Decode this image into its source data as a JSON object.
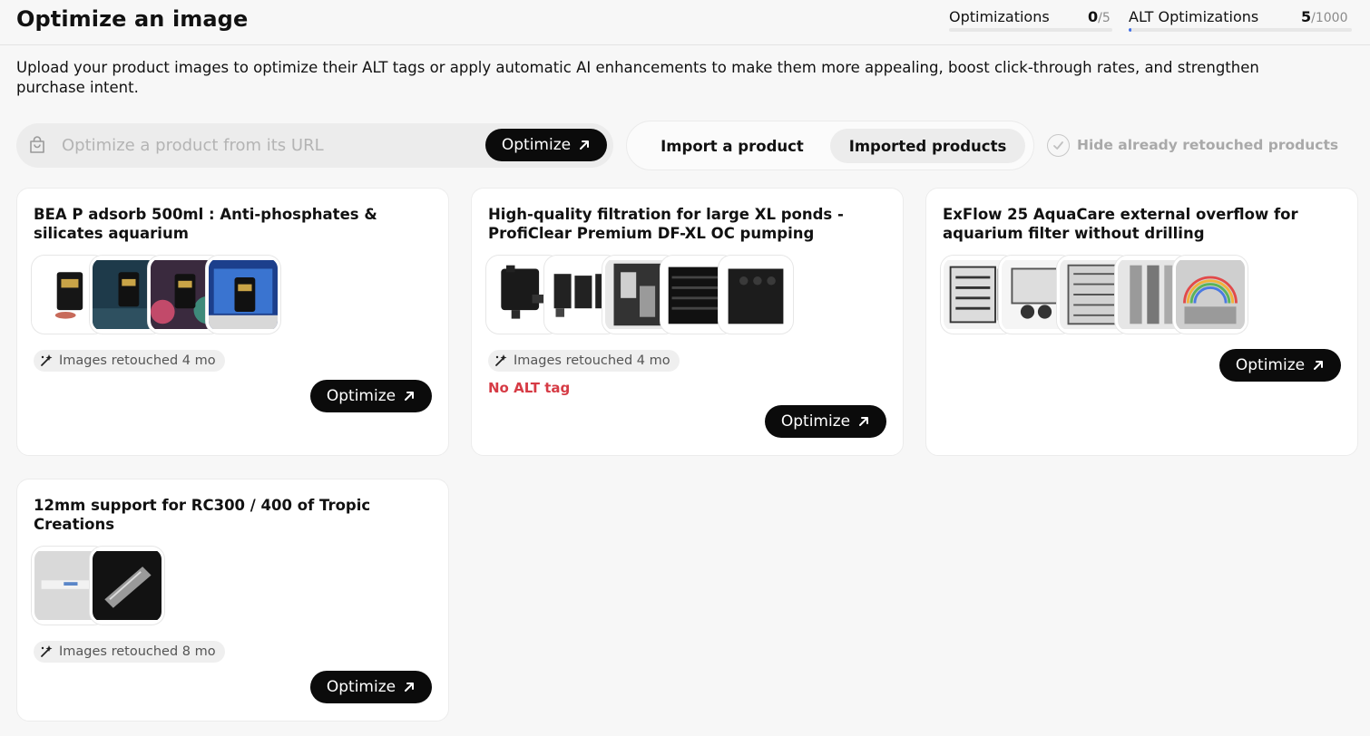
{
  "header": {
    "title": "Optimize an image",
    "stats": [
      {
        "label": "Optimizations",
        "used": "0",
        "total": "/5",
        "progress": 0.0
      },
      {
        "label": "ALT Optimizations",
        "used": "5",
        "total": "/1000",
        "progress": 0.005
      }
    ]
  },
  "description": "Upload your product images to optimize their ALT tags or apply automatic AI enhancements to make them more appealing, boost click-through rates, and strengthen purchase intent.",
  "url_search": {
    "placeholder": "Optimize a product from its URL",
    "value": "",
    "button_label": "Optimize"
  },
  "tabs": [
    {
      "label": "Import a product",
      "active": false
    },
    {
      "label": "Imported products",
      "active": true
    }
  ],
  "hide_retouched": {
    "label": "Hide already retouched products",
    "checked": false
  },
  "products": [
    {
      "title": "BEA P adsorb 500ml : Anti-phosphates & silicates aquarium",
      "image_count": 4,
      "badge": "Images retouched 4 mo",
      "alt_warning": "",
      "button_label": "Optimize"
    },
    {
      "title": "High-quality filtration for large XL ponds - ProfiClear Premium DF-XL OC pumping",
      "image_count": 5,
      "badge": "Images retouched 4 mo",
      "alt_warning": "No ALT tag",
      "button_label": "Optimize"
    },
    {
      "title": "ExFlow 25 AquaCare external overflow for aquarium filter without drilling",
      "image_count": 5,
      "badge": "",
      "alt_warning": "",
      "button_label": "Optimize"
    },
    {
      "title": "12mm support for RC300 / 400 of Tropic Creations",
      "image_count": 2,
      "badge": "Images retouched 8 mo",
      "alt_warning": "",
      "button_label": "Optimize"
    }
  ],
  "colors": {
    "accent": "#3f6ee8",
    "button": "#0b0b0b",
    "warning": "#d63b45",
    "background": "#f7f7f7"
  },
  "icons": {
    "url_field": "shopping-bag-icon",
    "button": "arrow-up-right-icon",
    "badge": "sparkle-wand-icon",
    "checkbox": "check-icon"
  }
}
